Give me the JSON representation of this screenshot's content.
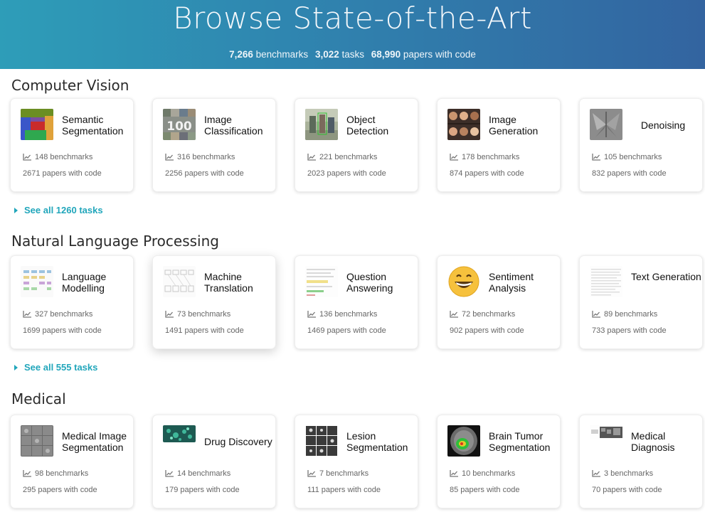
{
  "hero": {
    "title": "Browse State-of-the-Art",
    "benchmarks_num": "7,266",
    "benchmarks_label": "benchmarks",
    "tasks_num": "3,022",
    "tasks_label": "tasks",
    "papers_num": "68,990",
    "papers_label": "papers with code"
  },
  "sections": [
    {
      "title": "Computer Vision",
      "see_all": "See all 1260 tasks",
      "cards": [
        {
          "name": "Semantic Segmentation",
          "benchmarks": "148 benchmarks",
          "papers": "2671 papers with code"
        },
        {
          "name": "Image Classification",
          "benchmarks": "316 benchmarks",
          "papers": "2256 papers with code"
        },
        {
          "name": "Object Detection",
          "benchmarks": "221 benchmarks",
          "papers": "2023 papers with code"
        },
        {
          "name": "Image Generation",
          "benchmarks": "178 benchmarks",
          "papers": "874 papers with code"
        },
        {
          "name": "Denoising",
          "benchmarks": "105 benchmarks",
          "papers": "832 papers with code"
        }
      ]
    },
    {
      "title": "Natural Language Processing",
      "see_all": "See all 555 tasks",
      "cards": [
        {
          "name": "Language Modelling",
          "benchmarks": "327 benchmarks",
          "papers": "1699 papers with code"
        },
        {
          "name": "Machine Translation",
          "benchmarks": "73 benchmarks",
          "papers": "1491 papers with code"
        },
        {
          "name": "Question Answering",
          "benchmarks": "136 benchmarks",
          "papers": "1469 papers with code"
        },
        {
          "name": "Sentiment Analysis",
          "benchmarks": "72 benchmarks",
          "papers": "902 papers with code"
        },
        {
          "name": "Text Generation",
          "benchmarks": "89 benchmarks",
          "papers": "733 papers with code"
        }
      ]
    },
    {
      "title": "Medical",
      "cards": [
        {
          "name": "Medical Image Segmentation",
          "benchmarks": "98 benchmarks",
          "papers": "295 papers with code"
        },
        {
          "name": "Drug Discovery",
          "benchmarks": "14 benchmarks",
          "papers": "179 papers with code"
        },
        {
          "name": "Lesion Segmentation",
          "benchmarks": "7 benchmarks",
          "papers": "111 papers with code"
        },
        {
          "name": "Brain Tumor Segmentation",
          "benchmarks": "10 benchmarks",
          "papers": "85 papers with code"
        },
        {
          "name": "Medical Diagnosis",
          "benchmarks": "3 benchmarks",
          "papers": "70 papers with code"
        }
      ]
    }
  ]
}
